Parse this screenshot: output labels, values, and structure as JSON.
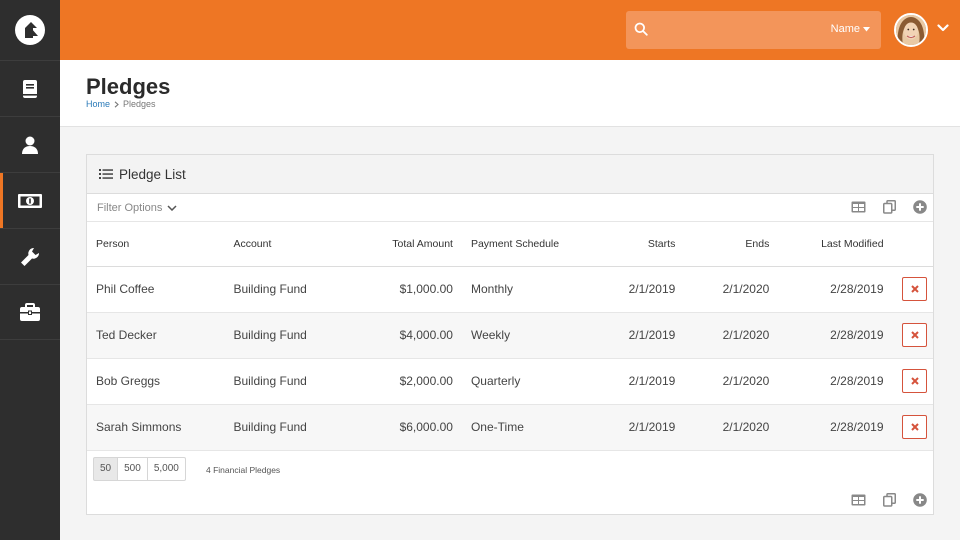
{
  "header": {
    "search_placeholder": "",
    "search_type": "Name"
  },
  "page": {
    "title": "Pledges",
    "breadcrumb": [
      "Home",
      "Pledges"
    ]
  },
  "panel": {
    "title": "Pledge List",
    "filter_label": "Filter Options"
  },
  "table": {
    "columns": [
      "Person",
      "Account",
      "Total Amount",
      "Payment Schedule",
      "Starts",
      "Ends",
      "Last Modified"
    ],
    "rows": [
      [
        "Phil Coffee",
        "Building Fund",
        "$1,000.00",
        "Monthly",
        "2/1/2019",
        "2/1/2020",
        "2/28/2019"
      ],
      [
        "Ted Decker",
        "Building Fund",
        "$4,000.00",
        "Weekly",
        "2/1/2019",
        "2/1/2020",
        "2/28/2019"
      ],
      [
        "Bob Greggs",
        "Building Fund",
        "$2,000.00",
        "Quarterly",
        "2/1/2019",
        "2/1/2020",
        "2/28/2019"
      ],
      [
        "Sarah Simmons",
        "Building Fund",
        "$6,000.00",
        "One-Time",
        "2/1/2019",
        "2/1/2020",
        "2/28/2019"
      ]
    ]
  },
  "pager": {
    "sizes": [
      "50",
      "500",
      "5,000"
    ],
    "active": "50",
    "count_label": "4 Financial Pledges"
  },
  "colors": {
    "brand": "#ee7624",
    "sidebar": "#2e2e2e",
    "delete": "#d5533c",
    "link": "#2a7ab8"
  },
  "icons": {
    "sidebar": [
      "book-icon",
      "person-icon",
      "money-icon",
      "wrench-icon",
      "briefcase-icon"
    ],
    "grid_actions": [
      "excel-export-icon",
      "merge-template-icon",
      "add-icon"
    ]
  }
}
